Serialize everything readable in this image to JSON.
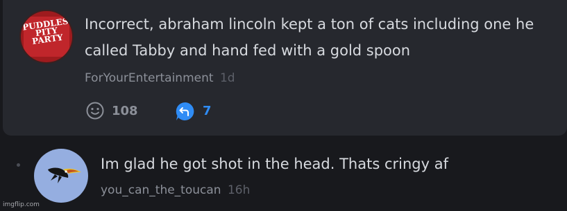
{
  "comment1": {
    "avatar_text": "PUDDLES PITY PARTY",
    "text": "Incorrect, abraham lincoln kept a ton of cats including one he called Tabby and hand fed with a gold spoon",
    "author": "ForYourEntertainment",
    "age": "1d",
    "likes": "108",
    "replies": "7"
  },
  "comment2": {
    "text": "Im glad he got shot in the head. Thats cringy af",
    "author": "you_can_the_toucan",
    "age": "16h"
  },
  "watermark": "imgflip.com",
  "colors": {
    "background": "#18191d",
    "card": "#26282e",
    "text": "#d7dadf",
    "muted": "#8c9099",
    "reply_accent": "#2f8cf5"
  },
  "icons": {
    "like": "smile-icon",
    "reply": "reply-bubble-icon",
    "thread": "thread-dot-icon"
  }
}
